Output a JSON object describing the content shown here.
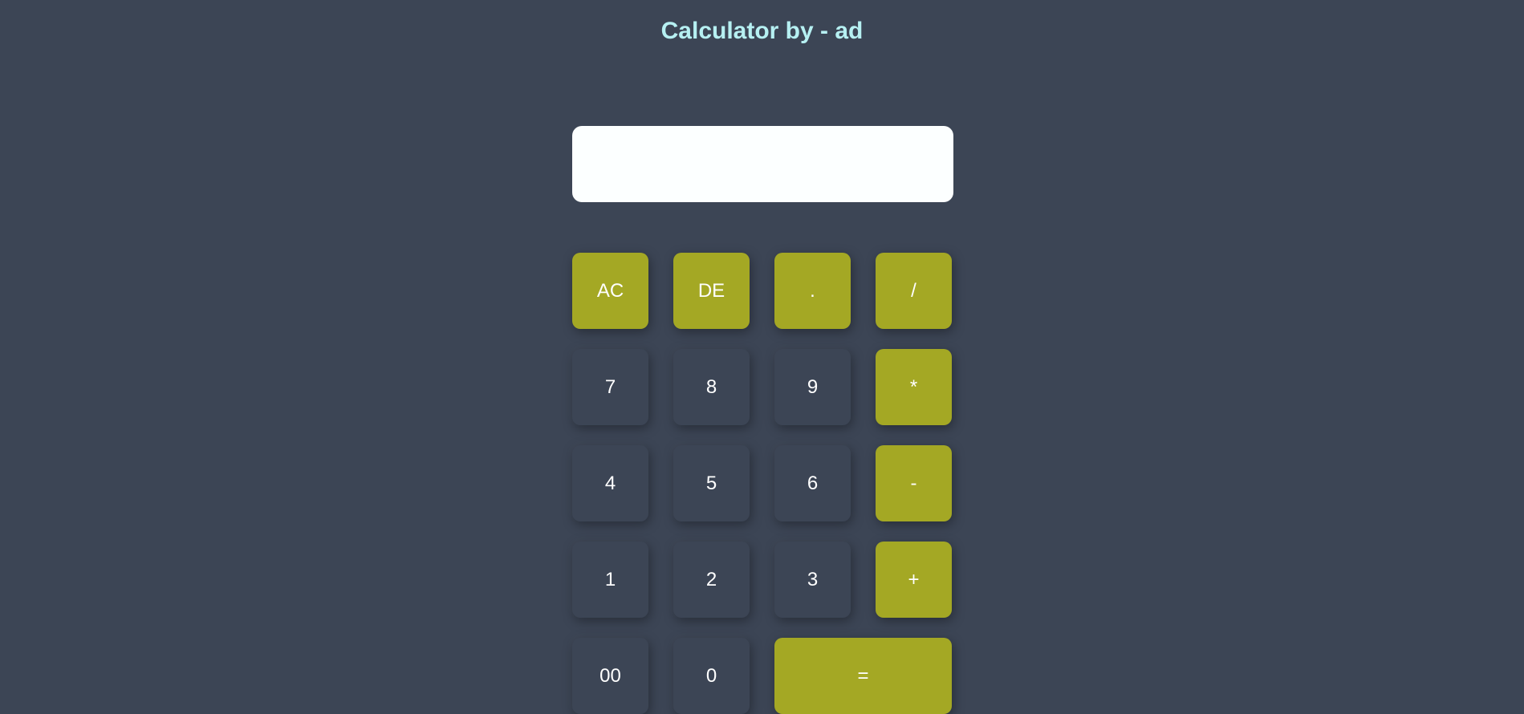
{
  "app": {
    "title": "Calculator by - ad"
  },
  "display": {
    "value": ""
  },
  "colors": {
    "background": "#3c4555",
    "operator": "#a4a824",
    "display": "#fcffff",
    "title": "#b6f0f2"
  },
  "keys": {
    "ac": "AC",
    "de": "DE",
    "dot": ".",
    "divide": "/",
    "seven": "7",
    "eight": "8",
    "nine": "9",
    "multiply": "*",
    "four": "4",
    "five": "5",
    "six": "6",
    "subtract": "-",
    "one": "1",
    "two": "2",
    "three": "3",
    "add": "+",
    "double_zero": "00",
    "zero": "0",
    "equals": "="
  }
}
